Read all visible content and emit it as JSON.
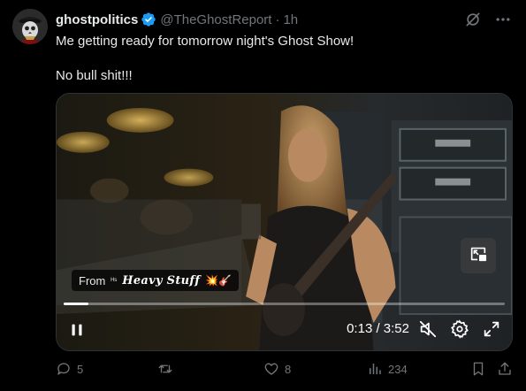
{
  "post": {
    "author": {
      "display_name": "ghostpolitics",
      "handle": "@TheGhostReport",
      "separator": "·",
      "time": "1h",
      "verified": true
    },
    "text_lines": [
      "Me getting ready for tomorrow night's Ghost Show!",
      "No bull shit!!!"
    ]
  },
  "video": {
    "from_label": "From",
    "source_name": "Heavy Stuff",
    "source_emoji": "💥🎸",
    "timecode": "0:13 / 3:52",
    "progress": 0.056,
    "state": "paused"
  },
  "actions": {
    "reply_count": "5",
    "repost_count": "",
    "like_count": "8",
    "views_count": "234"
  },
  "colors": {
    "background": "#000000",
    "text": "#e7e9ea",
    "secondary": "#71767b",
    "verified": "#1d9bf0"
  },
  "icons": {
    "verified": "verified-badge-icon",
    "grok": "grok-icon",
    "more": "more-icon",
    "pip": "picture-in-picture-icon",
    "pause": "pause-icon",
    "mute": "muted-speaker-icon",
    "settings": "gear-icon",
    "fullscreen": "fullscreen-icon",
    "reply": "reply-icon",
    "repost": "repost-icon",
    "like": "heart-icon",
    "views": "views-chart-icon",
    "bookmark": "bookmark-icon",
    "share": "share-icon"
  }
}
